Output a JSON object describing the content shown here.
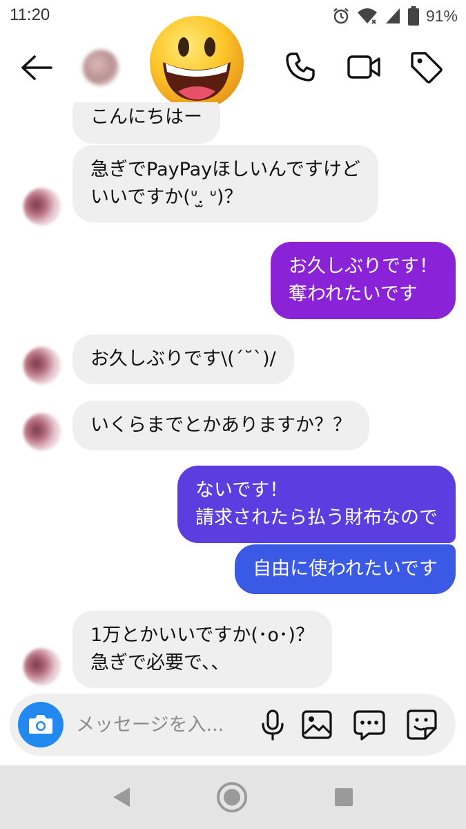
{
  "status_bar": {
    "time": "11:20",
    "battery_percent": "91%",
    "icons": [
      "alarm-icon",
      "wifi-icon",
      "signal-icon",
      "battery-icon"
    ]
  },
  "header": {
    "icons": [
      "back-arrow-icon",
      "phone-icon",
      "video-camera-icon",
      "tag-icon"
    ],
    "overlay_emoji": "grinning-face"
  },
  "messages": [
    {
      "direction": "incoming",
      "lines": [
        "こんにちはー"
      ]
    },
    {
      "direction": "incoming",
      "lines": [
        "急ぎでPayPayほしいんですけど",
        "いいですか(ᐡ.̫ ᐡ)？"
      ]
    },
    {
      "direction": "outgoing",
      "lines": [
        "お久しぶりです！",
        "奪われたいです"
      ]
    },
    {
      "direction": "incoming",
      "lines": [
        "お久しぶりです\\(´˘`)/"
      ]
    },
    {
      "direction": "incoming",
      "lines": [
        "いくらまでとかありますか？？"
      ]
    },
    {
      "direction": "outgoing",
      "lines": [
        "ないです！",
        "請求されたら払う財布なので"
      ]
    },
    {
      "direction": "outgoing",
      "lines": [
        "自由に使われたいです"
      ]
    },
    {
      "direction": "incoming",
      "lines": [
        "1万とかいいですか(･o･)？",
        "急ぎで必要で、、"
      ]
    }
  ],
  "composer": {
    "placeholder": "メッセージを入...",
    "icons": [
      "camera-icon",
      "microphone-icon",
      "image-icon",
      "message-bubble-icon",
      "sticker-icon"
    ]
  },
  "colors": {
    "incoming_bubble": "#efefef",
    "outgoing_purple": "#8a23d8",
    "outgoing_indigo": "#5b3ee0",
    "outgoing_blue": "#3a5ae5",
    "camera_button": "#2289f0",
    "nav_bar": "#e4e4e4"
  },
  "nav_bar": {
    "icons": [
      "back-triangle-icon",
      "home-circle-icon",
      "recents-square-icon"
    ]
  }
}
